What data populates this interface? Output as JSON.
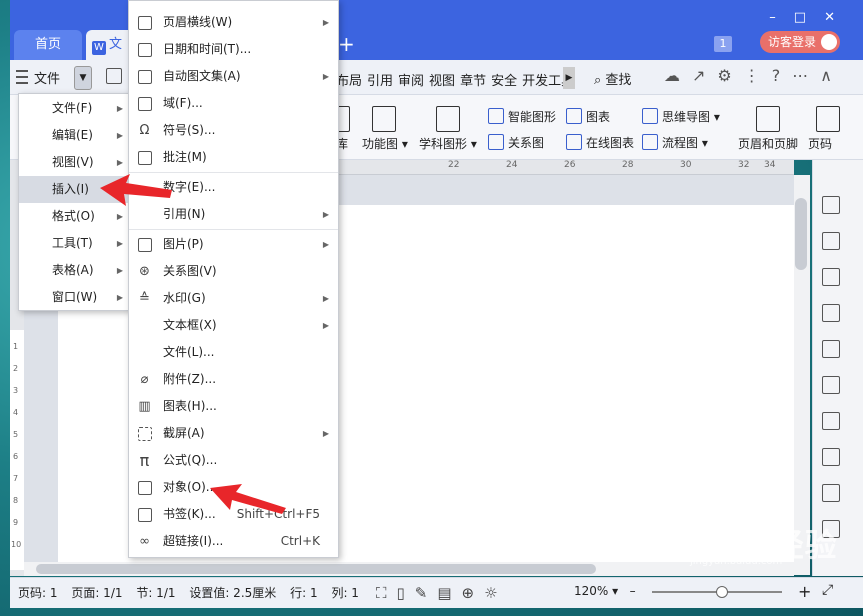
{
  "title_bar": {
    "tabs": [
      {
        "label": "首页"
      },
      {
        "label": "文"
      }
    ],
    "doc_icon_glyph": "W",
    "badge": "1",
    "guest_login": "访客登录"
  },
  "toolbar": {
    "file_menu": "文件",
    "ribbon_tabs": [
      "布局",
      "引用",
      "审阅",
      "视图",
      "章节",
      "安全",
      "开发工具"
    ],
    "search": "查找"
  },
  "ribbon": {
    "items": [
      "库",
      "功能图",
      "学科图形",
      "智能图形",
      "图表",
      "关系图",
      "在线图表",
      "思维导图",
      "流程图",
      "页眉和页脚",
      "页码"
    ]
  },
  "ruler": {
    "ticks": [
      "22",
      "24",
      "26",
      "28",
      "30",
      "32",
      "34"
    ],
    "left_ticks": [
      "1",
      "2",
      "3",
      "4",
      "5",
      "6",
      "7",
      "8",
      "9",
      "10"
    ]
  },
  "main_menu": {
    "items": [
      {
        "label": "文件(F)",
        "selected": false
      },
      {
        "label": "编辑(E)",
        "selected": false
      },
      {
        "label": "视图(V)",
        "selected": false
      },
      {
        "label": "插入(I)",
        "selected": true
      },
      {
        "label": "格式(O)",
        "selected": false
      },
      {
        "label": "工具(T)",
        "selected": false
      },
      {
        "label": "表格(A)",
        "selected": false
      },
      {
        "label": "窗口(W)",
        "selected": false
      }
    ]
  },
  "insert_submenu": {
    "items": [
      {
        "label": "页眉横线(W)",
        "icon": "header-line-icon",
        "submenu": true
      },
      {
        "label": "日期和时间(T)...",
        "icon": "calendar-icon"
      },
      {
        "label": "自动图文集(A)",
        "icon": "autotext-icon",
        "submenu": true
      },
      {
        "label": "域(F)...",
        "icon": "field-icon"
      },
      {
        "label": "符号(S)...",
        "icon": "omega-icon"
      },
      {
        "label": "批注(M)",
        "icon": "comment-icon"
      },
      {
        "label": "数字(E)...",
        "icon": "number-icon"
      },
      {
        "label": "引用(N)",
        "icon": "reference-icon",
        "submenu": true
      },
      {
        "label": "图片(P)",
        "icon": "picture-icon",
        "submenu": true
      },
      {
        "label": "关系图(V)",
        "icon": "relation-icon"
      },
      {
        "label": "水印(G)",
        "icon": "watermark-icon",
        "submenu": true
      },
      {
        "label": "文本框(X)",
        "icon": "textbox-icon",
        "submenu": true
      },
      {
        "label": "文件(L)...",
        "icon": "file-icon"
      },
      {
        "label": "附件(Z)...",
        "icon": "paperclip-icon"
      },
      {
        "label": "图表(H)...",
        "icon": "chart-icon"
      },
      {
        "label": "截屏(A)",
        "icon": "screenshot-icon",
        "submenu": true
      },
      {
        "label": "公式(Q)...",
        "icon": "pi-icon"
      },
      {
        "label": "对象(O)...",
        "icon": "object-icon"
      },
      {
        "label": "书签(K)...",
        "icon": "bookmark-icon",
        "shortcut": "Shift+Ctrl+F5"
      },
      {
        "label": "超链接(I)...",
        "icon": "link-icon",
        "shortcut": "Ctrl+K"
      }
    ]
  },
  "status_bar": {
    "page_code": "页码: 1",
    "page": "页面: 1/1",
    "section": "节: 1/1",
    "setting": "设置值: 2.5厘米",
    "row": "行: 1",
    "col": "列: 1",
    "zoom": "120%"
  },
  "watermark": {
    "text": "Baidu经验",
    "sub": "jingyan.baidu.com"
  },
  "colors": {
    "accent": "#3c64e0",
    "arrow": "#e8262a",
    "guest": "#e9706a"
  }
}
